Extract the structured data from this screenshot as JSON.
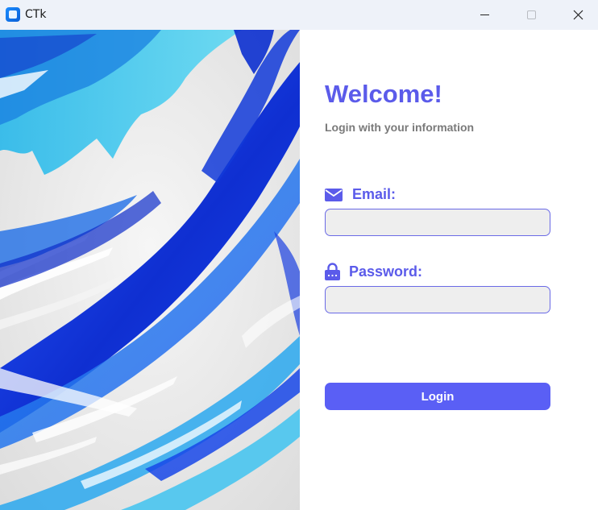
{
  "window": {
    "title": "CTk",
    "icon": "app-icon"
  },
  "login": {
    "heading": "Welcome!",
    "subtitle": "Login with your information",
    "email": {
      "label": "Email:",
      "icon": "envelope-icon",
      "value": "",
      "placeholder": ""
    },
    "password": {
      "label": "Password:",
      "icon": "lock-icon",
      "value": "",
      "placeholder": ""
    },
    "submit_label": "Login"
  },
  "colors": {
    "accent": "#5b5bea",
    "button": "#5a5ff5",
    "field_bg": "#eeeeee",
    "subtitle": "#7a7a7a",
    "titlebar": "#eef2f9"
  }
}
